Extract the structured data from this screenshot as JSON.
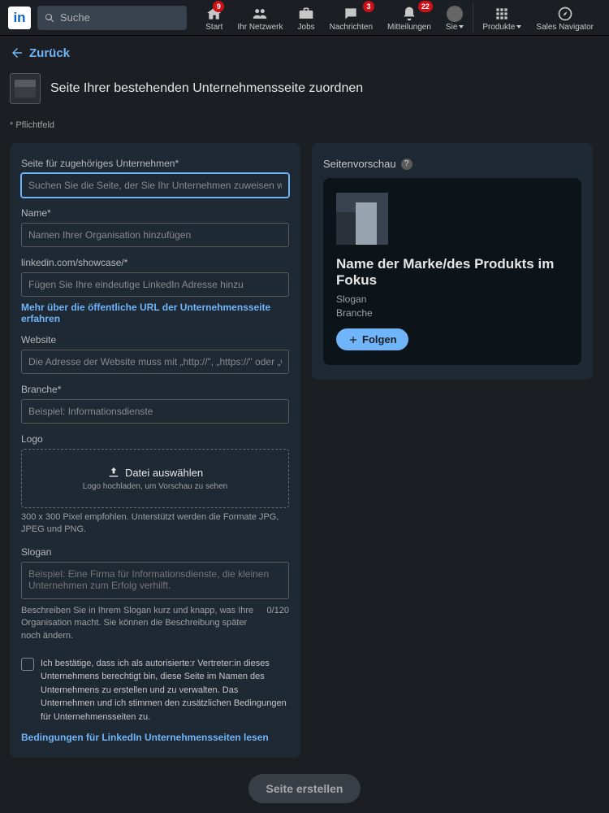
{
  "logo_text": "in",
  "search": {
    "placeholder": "Suche"
  },
  "nav": {
    "home": {
      "label": "Start",
      "badge": "9"
    },
    "network": {
      "label": "Ihr Netzwerk"
    },
    "jobs": {
      "label": "Jobs"
    },
    "messaging": {
      "label": "Nachrichten",
      "badge": "3"
    },
    "notifications": {
      "label": "Mitteilungen",
      "badge": "22"
    },
    "me": {
      "label": "Sie"
    },
    "products": {
      "label": "Produkte"
    },
    "sales": {
      "label": "Sales Navigator"
    }
  },
  "back_label": "Zurück",
  "page_title": "Seite Ihrer bestehenden Unternehmensseite zuordnen",
  "required_note": "* Pflichtfeld",
  "form": {
    "parent": {
      "label": "Seite für zugehöriges Unternehmen*",
      "placeholder": "Suchen Sie die Seite, der Sie Ihr Unternehmen zuweisen wollen"
    },
    "name": {
      "label": "Name*",
      "placeholder": "Namen Ihrer Organisation hinzufügen"
    },
    "url": {
      "label": "linkedin.com/showcase/*",
      "placeholder": "Fügen Sie Ihre eindeutige LinkedIn Adresse hinzu"
    },
    "url_help": "Mehr über die öffentliche URL der Unternehmensseite erfahren",
    "website": {
      "label": "Website",
      "placeholder": "Die Adresse der Website muss mit „http://\", „https://\" oder „www.\" beginnen."
    },
    "industry": {
      "label": "Branche*",
      "placeholder": "Beispiel: Informationsdienste"
    },
    "logo": {
      "label": "Logo",
      "button": "Datei auswählen",
      "sub": "Logo hochladen, um Vorschau zu sehen",
      "hint": "300 x 300 Pixel empfohlen. Unterstützt werden die Formate JPG, JPEG und PNG."
    },
    "tagline": {
      "label": "Slogan",
      "placeholder": "Beispiel: Eine Firma für Informationsdienste, die kleinen Unternehmen zum Erfolg verhilft.",
      "hint": "Beschreiben Sie in Ihrem Slogan kurz und knapp, was Ihre Organisation macht. Sie können die Beschreibung später noch ändern.",
      "counter": "0/120"
    },
    "checkbox": "Ich bestätige, dass ich als autorisierte:r Vertreter:in dieses Unternehmens berechtigt bin, diese Seite im Namen des Unternehmens zu erstellen und zu verwalten. Das Unternehmen und ich stimmen den zusätzlichen Bedingungen für Unternehmensseiten zu.",
    "terms_link": "Bedingungen für LinkedIn Unternehmensseiten lesen"
  },
  "preview": {
    "header": "Seitenvorschau",
    "title": "Name der Marke/des Produkts im Fokus",
    "tagline": "Slogan",
    "industry": "Branche",
    "follow": "Folgen"
  },
  "create_label": "Seite erstellen"
}
